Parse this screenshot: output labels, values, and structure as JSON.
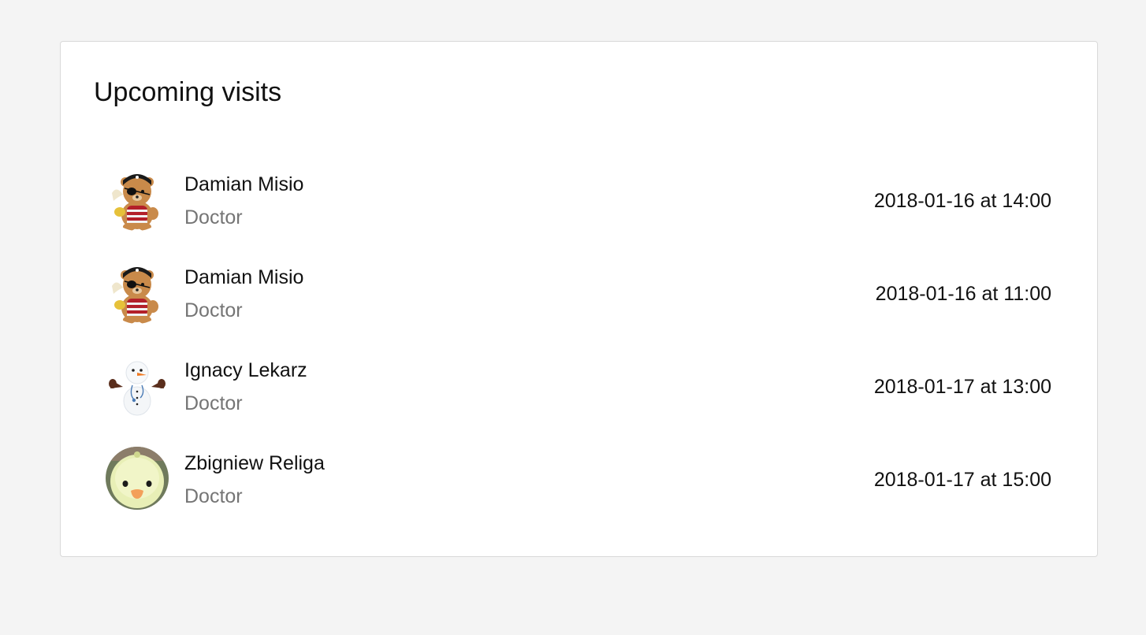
{
  "card": {
    "title": "Upcoming visits"
  },
  "visits": [
    {
      "name": "Damian Misio",
      "role": "Doctor",
      "datetime": "2018-01-16 at 14:00",
      "avatar": "pirate-bear-icon"
    },
    {
      "name": "Damian Misio",
      "role": "Doctor",
      "datetime": "2018-01-16 at 11:00",
      "avatar": "pirate-bear-icon"
    },
    {
      "name": "Ignacy Lekarz",
      "role": "Doctor",
      "datetime": "2018-01-17 at 13:00",
      "avatar": "snowman-doctor-icon"
    },
    {
      "name": "Zbigniew Religa",
      "role": "Doctor",
      "datetime": "2018-01-17 at 15:00",
      "avatar": "chick-icon"
    }
  ],
  "colors": {
    "background": "#f4f4f4",
    "card": "#ffffff",
    "text": "#111111",
    "secondary_text": "#757575"
  }
}
